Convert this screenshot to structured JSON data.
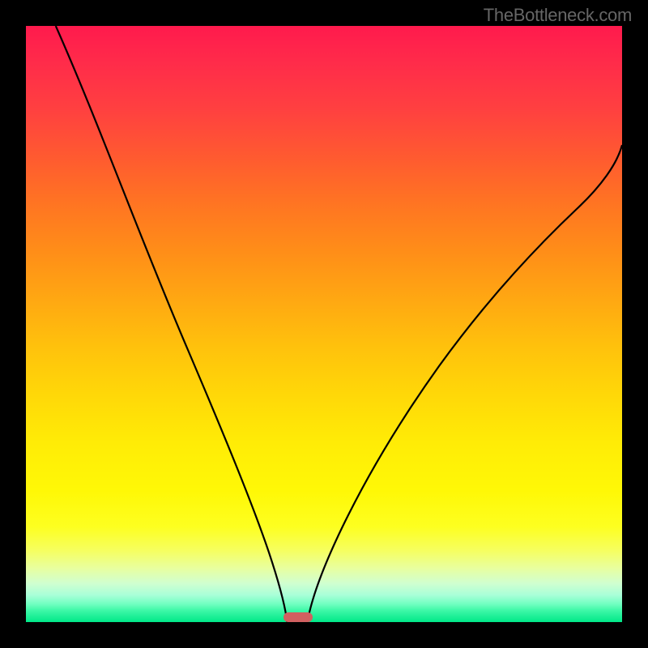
{
  "watermark": "TheBottleneck.com",
  "chart_data": {
    "type": "line",
    "title": "",
    "xlabel": "",
    "ylabel": "",
    "xlim": [
      0,
      100
    ],
    "ylim": [
      0,
      100
    ],
    "grid": false,
    "series": [
      {
        "name": "left-curve",
        "x": [
          5,
          10,
          14,
          18,
          22,
          26,
          30,
          33,
          36,
          38.5,
          40.5,
          42,
          43,
          43.8
        ],
        "values": [
          100,
          85,
          72,
          60,
          49,
          39,
          30,
          22,
          15,
          9,
          5,
          2.5,
          1,
          0
        ]
      },
      {
        "name": "right-curve",
        "x": [
          47.2,
          49,
          52,
          56,
          60,
          65,
          70,
          76,
          82,
          88,
          94,
          100
        ],
        "values": [
          0,
          2,
          6,
          13,
          21,
          31,
          41,
          52,
          61,
          69,
          75,
          80
        ]
      }
    ],
    "marker": {
      "x": 45.5,
      "y": 0.5,
      "width": 4.5,
      "height": 1.6
    },
    "gradient_stops": [
      {
        "pos": 0,
        "color": "#ff1a4d"
      },
      {
        "pos": 100,
        "color": "#00e888"
      }
    ]
  }
}
